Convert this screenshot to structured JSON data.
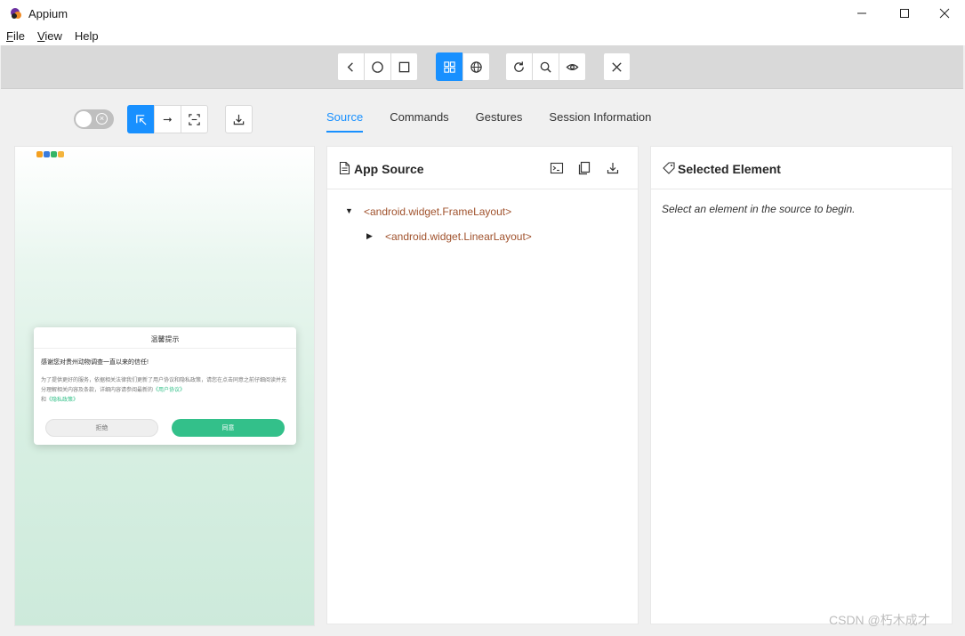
{
  "window": {
    "title": "Appium",
    "controls": [
      "minimize-icon",
      "maximize-icon",
      "close-icon"
    ]
  },
  "menu": {
    "items": [
      {
        "accel": "F",
        "rest": "ile"
      },
      {
        "accel": "V",
        "rest": "iew"
      },
      {
        "accel": "",
        "rest": "Help"
      }
    ]
  },
  "toolbar": {
    "nav_icons": [
      "back-icon",
      "home-icon",
      "app-switch-icon"
    ],
    "context_icons": [
      "native-app-mode-icon",
      "web-context-icon"
    ],
    "context_active": "native-app-mode-icon",
    "action_icons": [
      "refresh-icon",
      "search-icon",
      "eye-icon"
    ],
    "quit_icon": "close-session-icon",
    "accent_color": "#1890ff"
  },
  "left_tools": {
    "toggle_on": false,
    "mode_icons": [
      "select-elements-icon",
      "swipe-icon",
      "tap-coordinates-icon"
    ],
    "mode_active": "select-elements-icon",
    "download_icon": "download-screenshot-icon"
  },
  "device": {
    "status_dot_colors": [
      "#f4a020",
      "#3a7bdc",
      "#35b567",
      "#f4b43c"
    ],
    "dialog": {
      "title": "温馨提示",
      "lead": "感谢您对贵州动物调查一直以来的信任!",
      "body_text": "为了提供更好的服务，依据相关法律我们更新了用户协议和隐私政策，请您在点击同意之前仔细阅读并充分理解相关内容及条款，详细内容请参阅最新的",
      "link_user_agreement": "《用户协议》",
      "and_text": "和",
      "link_privacy": "《隐私政策》",
      "decline_label": "拒绝",
      "agree_label": "同意",
      "agree_color": "#33c08a"
    }
  },
  "tabs": {
    "items": [
      "Source",
      "Commands",
      "Gestures",
      "Session Information"
    ],
    "active": "Source"
  },
  "source_panel": {
    "title": "App Source",
    "title_icon": "document-icon",
    "header_icons": [
      "terminal-icon",
      "copy-icon",
      "download-icon"
    ],
    "tree": [
      {
        "label": "<android.widget.FrameLayout>",
        "expanded": true,
        "depth": 0
      },
      {
        "label": "<android.widget.LinearLayout>",
        "expanded": false,
        "depth": 1
      }
    ]
  },
  "element_panel": {
    "title": "Selected Element",
    "title_icon": "tag-icon",
    "hint": "Select an element in the source to begin."
  },
  "watermark": "CSDN @朽木成才"
}
